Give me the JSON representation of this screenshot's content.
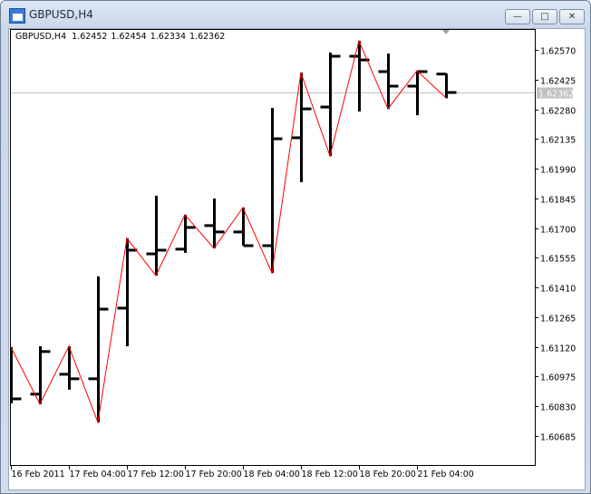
{
  "window": {
    "title": "GBPUSD,H4",
    "minimize_label": "—",
    "maximize_label": "□",
    "close_label": "✕"
  },
  "chart_info": {
    "symbol": "GBPUSD,H4",
    "open": "1.62452",
    "high": "1.62454",
    "low": "1.62334",
    "close": "1.62362"
  },
  "bid_label": "1.62362",
  "chart_data": {
    "type": "ohlc",
    "title": "GBPUSD,H4",
    "bar_color": "#000000",
    "zigzag_color": "#ff0000",
    "bid_line_color": "#c0c0c0",
    "bid_price": 1.62362,
    "ylim": [
      1.60543,
      1.62672
    ],
    "y_ticks": [
      "1.62570",
      "1.62425",
      "1.62280",
      "1.62135",
      "1.61990",
      "1.61845",
      "1.61700",
      "1.61555",
      "1.61410",
      "1.61265",
      "1.61120",
      "1.60975",
      "1.60830",
      "1.60685"
    ],
    "x_ticks": [
      {
        "bar": 0,
        "label": "16 Feb 2011"
      },
      {
        "bar": 2,
        "label": "17 Feb 04:00"
      },
      {
        "bar": 4,
        "label": "17 Feb 12:00"
      },
      {
        "bar": 6,
        "label": "17 Feb 20:00"
      },
      {
        "bar": 8,
        "label": "18 Feb 04:00"
      },
      {
        "bar": 10,
        "label": "18 Feb 12:00"
      },
      {
        "bar": 12,
        "label": "18 Feb 20:00"
      },
      {
        "bar": 14,
        "label": "21 Feb 04:00"
      }
    ],
    "bars": [
      {
        "o": 1.60866,
        "h": 1.61119,
        "l": 1.60844,
        "c": 1.60866
      },
      {
        "o": 1.60889,
        "h": 1.61123,
        "l": 1.6084,
        "c": 1.61097
      },
      {
        "o": 1.60986,
        "h": 1.61123,
        "l": 1.60911,
        "c": 1.60964
      },
      {
        "o": 1.60964,
        "h": 1.61464,
        "l": 1.60751,
        "c": 1.61304
      },
      {
        "o": 1.61309,
        "h": 1.6165,
        "l": 1.61123,
        "c": 1.61592
      },
      {
        "o": 1.61574,
        "h": 1.61858,
        "l": 1.61468,
        "c": 1.61592
      },
      {
        "o": 1.61597,
        "h": 1.61765,
        "l": 1.61579,
        "c": 1.61703
      },
      {
        "o": 1.61712,
        "h": 1.61844,
        "l": 1.61601,
        "c": 1.61681
      },
      {
        "o": 1.61681,
        "h": 1.618,
        "l": 1.61614,
        "c": 1.61614
      },
      {
        "o": 1.61614,
        "h": 1.62287,
        "l": 1.61481,
        "c": 1.62136
      },
      {
        "o": 1.62141,
        "h": 1.62459,
        "l": 1.61924,
        "c": 1.62282
      },
      {
        "o": 1.62291,
        "h": 1.62557,
        "l": 1.62052,
        "c": 1.62539
      },
      {
        "o": 1.62539,
        "h": 1.62614,
        "l": 1.62269,
        "c": 1.62521
      },
      {
        "o": 1.62464,
        "h": 1.62552,
        "l": 1.62282,
        "c": 1.62393
      },
      {
        "o": 1.62393,
        "h": 1.62468,
        "l": 1.62251,
        "c": 1.62464
      },
      {
        "o": 1.62452,
        "h": 1.62454,
        "l": 1.62334,
        "c": 1.62362
      }
    ],
    "zigzag": [
      1.61119,
      1.6084,
      1.61123,
      1.60751,
      1.6165,
      1.61468,
      1.61765,
      1.61601,
      1.618,
      1.61481,
      1.62459,
      1.62052,
      1.62614,
      1.62282,
      1.62468,
      1.62336
    ]
  }
}
